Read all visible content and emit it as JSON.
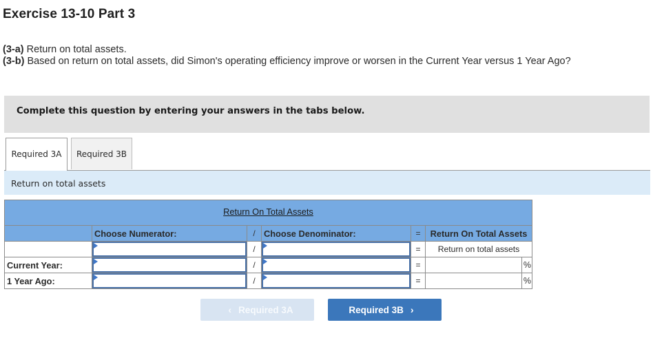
{
  "page": {
    "title": "Exercise 13-10 Part 3",
    "questions": [
      {
        "tag": "(3-a)",
        "text": " Return on total assets."
      },
      {
        "tag": "(3-b)",
        "text": " Based on return on total assets, did Simon's operating efficiency improve or worsen in the Current Year versus 1 Year Ago?"
      }
    ],
    "instruction": "Complete this question by entering your answers in the tabs below."
  },
  "tabs": [
    {
      "label": "Required 3A",
      "active": true
    },
    {
      "label": "Required 3B",
      "active": false
    }
  ],
  "subheader": "Return on total assets",
  "table": {
    "title": "Return On Total Assets",
    "col_numerator": "Choose Numerator:",
    "col_denominator": "Choose Denominator:",
    "col_result": "Return On Total Assets",
    "divide_symbol": "/",
    "equals_symbol": "=",
    "percent_symbol": "%",
    "rows": [
      {
        "label": "",
        "numerator": "",
        "denominator": "",
        "result": "Return on total assets"
      },
      {
        "label": "Current Year:",
        "numerator": "",
        "denominator": "",
        "result": ""
      },
      {
        "label": "1 Year Ago:",
        "numerator": "",
        "denominator": "",
        "result": ""
      }
    ]
  },
  "nav": {
    "prev_label": "Required 3A",
    "next_label": "Required 3B",
    "prev_icon": "chevron-left-icon",
    "next_icon": "chevron-right-icon"
  },
  "colors": {
    "table_header": "#76aae2",
    "subheader_bg": "#dbebf8",
    "next_button": "#3b77bb",
    "prev_button_disabled": "#d8e4f2",
    "input_border": "#4a72a8"
  }
}
